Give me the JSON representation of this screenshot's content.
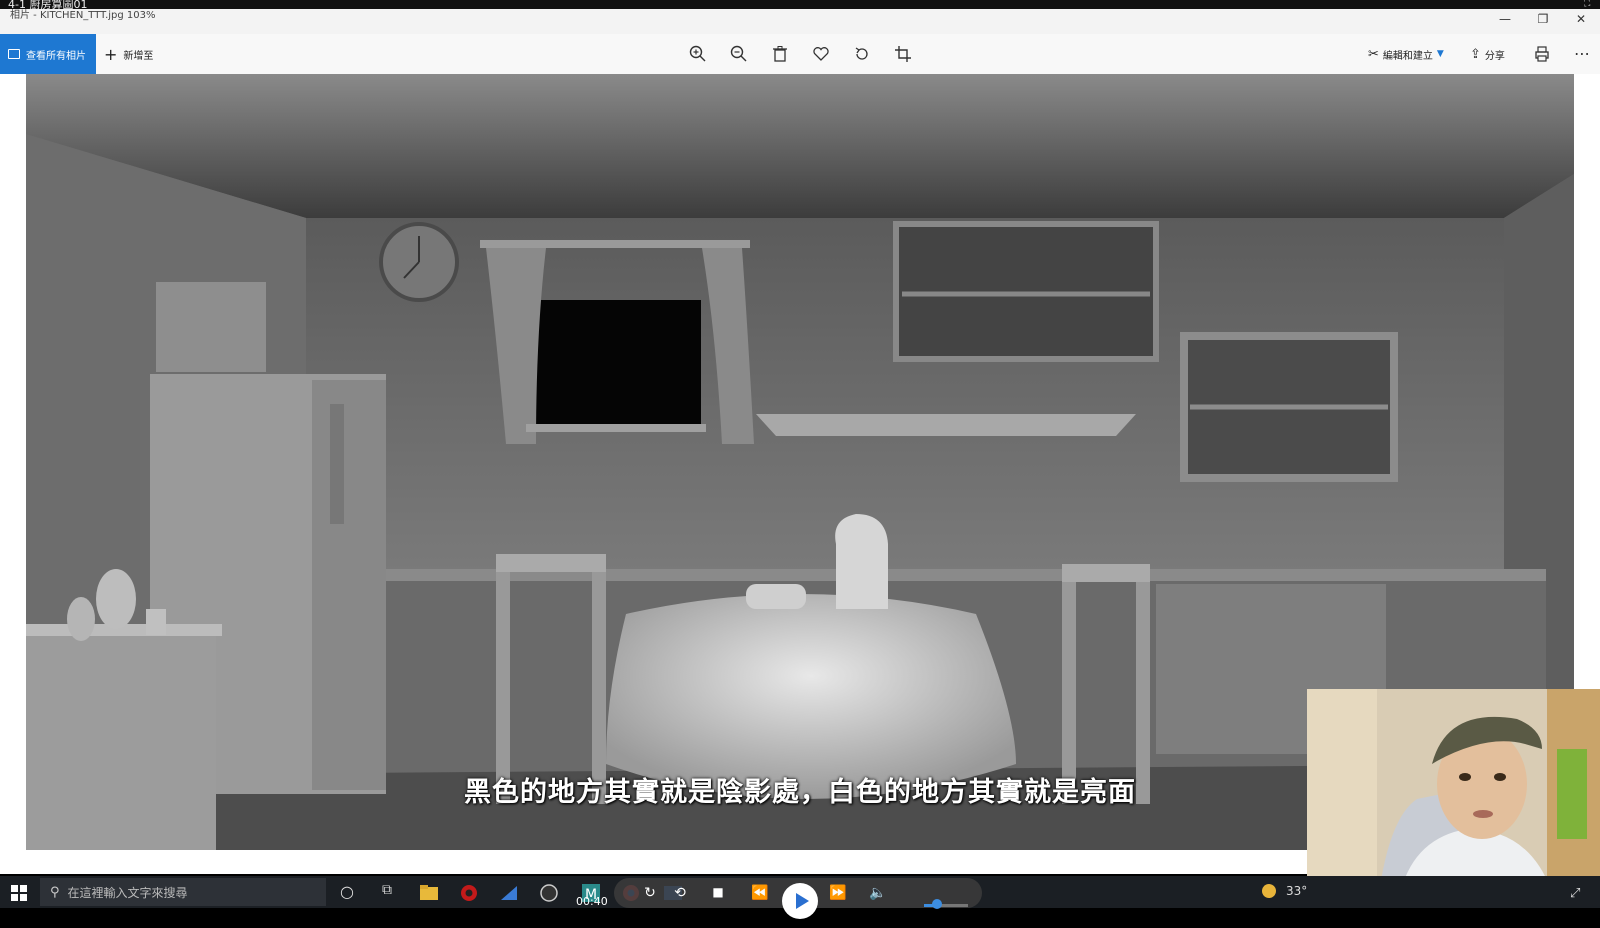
{
  "video": {
    "title": "4-1 廚房算圖01"
  },
  "window": {
    "title": "相片 - KITCHEN_TTT.jpg   103%"
  },
  "toolbar": {
    "view_all_label": "查看所有相片",
    "add_to_label": "新增至",
    "edit_create_label": "編輯和建立",
    "share_label": "分享",
    "icons": [
      "zoom-in-icon",
      "zoom-out-icon",
      "delete-icon",
      "favorite-icon",
      "rotate-icon",
      "crop-icon",
      "print-icon",
      "more-icon"
    ]
  },
  "subtitle": "黑色的地方其實就是陰影處，白色的地方其實就是亮面",
  "taskbar": {
    "search_placeholder": "在這裡輸入文字來搜尋",
    "temperature": "33°"
  },
  "media": {
    "time": "00:40",
    "volume_level": 0.3
  },
  "colors": {
    "accent": "#1e78d2",
    "taskbar": "#1b1f24"
  }
}
